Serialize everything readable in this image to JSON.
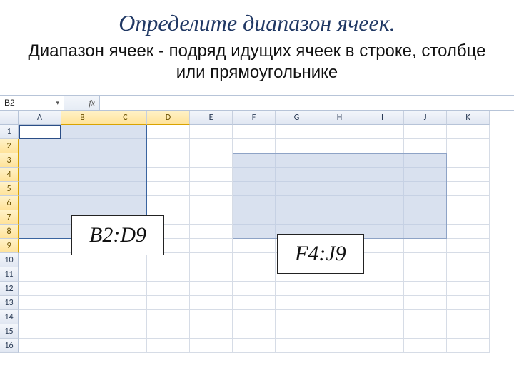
{
  "title": "Определите диапазон ячеек.",
  "subtitle": "Диапазон ячеек - подряд идущих ячеек в строке, столбце или прямоугольнике",
  "namebox": {
    "value": "B2",
    "drop": "▾"
  },
  "fx_label": "fx",
  "columns": [
    "A",
    "B",
    "C",
    "D",
    "E",
    "F",
    "G",
    "H",
    "I",
    "J",
    "K"
  ],
  "rows": [
    "1",
    "2",
    "3",
    "4",
    "5",
    "6",
    "7",
    "8",
    "9",
    "10",
    "11",
    "12",
    "13",
    "14",
    "15",
    "16"
  ],
  "selected_cols": [
    "B",
    "C",
    "D"
  ],
  "selected_rows": [
    "2",
    "3",
    "4",
    "5",
    "6",
    "7",
    "8",
    "9"
  ],
  "range_labels": {
    "first": "B2:D9",
    "second": "F4:J9"
  }
}
